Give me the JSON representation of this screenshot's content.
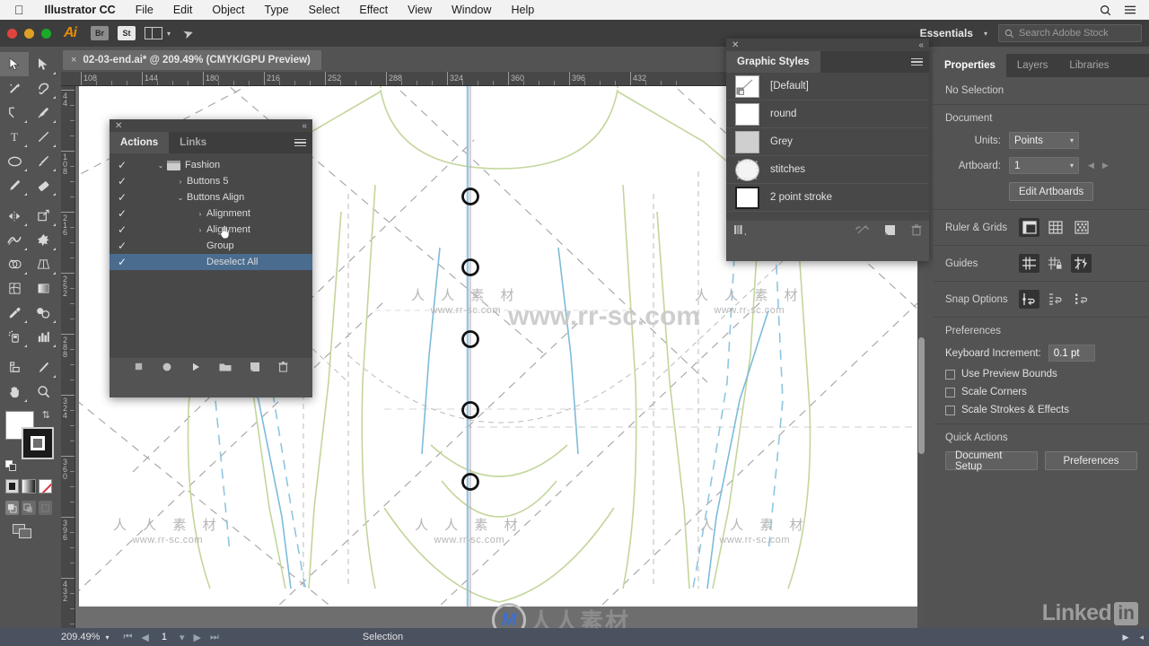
{
  "os_menu": {
    "apple": "apple-logo",
    "app_name": "Illustrator CC",
    "items": [
      "File",
      "Edit",
      "Object",
      "Type",
      "Select",
      "Effect",
      "View",
      "Window",
      "Help"
    ],
    "right_icons": [
      "search-icon",
      "control-center-icon"
    ]
  },
  "appbar": {
    "logo": "Ai",
    "bridge_label": "Br",
    "stock_label": "St",
    "arrange_label": "arrange-documents",
    "rocket_label": "rocket-icon",
    "workspace": "Essentials",
    "search_placeholder": "Search Adobe Stock"
  },
  "document": {
    "tab_title": "02-03-end.ai* @ 209.49% (CMYK/GPU Preview)",
    "close_glyph": "×"
  },
  "rulers": {
    "horizontal_ticks": [
      "108",
      "144",
      "180",
      "216",
      "252",
      "288",
      "324",
      "360",
      "396",
      "432"
    ],
    "vertical_ticks": [
      "44",
      "108",
      "216",
      "252",
      "288",
      "324",
      "360",
      "396",
      "432"
    ]
  },
  "tools": {
    "items": [
      "selection-tool",
      "direct-selection-tool",
      "magic-wand-tool",
      "lasso-tool",
      "pen-tool",
      "curvature-tool",
      "type-tool",
      "line-segment-tool",
      "ellipse-tool",
      "paintbrush-tool",
      "pencil-tool",
      "eraser-tool",
      "rotate-tool",
      "scale-tool",
      "width-tool",
      "free-transform-tool",
      "shape-builder-tool",
      "perspective-grid-tool",
      "mesh-tool",
      "gradient-tool",
      "eyedropper-tool",
      "blend-tool",
      "symbol-sprayer-tool",
      "column-graph-tool",
      "artboard-tool",
      "slice-tool",
      "hand-tool",
      "zoom-tool"
    ],
    "selected": "selection-tool",
    "fill_color": "#ffffff",
    "stroke_color": "#1a1a1a",
    "color_modes": [
      "color-mode",
      "gradient-mode",
      "none-mode"
    ],
    "draw_modes": [
      "draw-normal",
      "draw-behind",
      "draw-inside"
    ],
    "screen_mode": "change-screen-mode"
  },
  "actions_panel": {
    "tabs": [
      {
        "label": "Actions",
        "active": true
      },
      {
        "label": "Links",
        "active": false
      }
    ],
    "rows": [
      {
        "check": "✓",
        "indent": 0,
        "arrow": "⌄",
        "folder": true,
        "label": "Fashion",
        "selected": false
      },
      {
        "check": "✓",
        "indent": 1,
        "arrow": "›",
        "folder": false,
        "label": "Buttons 5",
        "selected": false
      },
      {
        "check": "✓",
        "indent": 1,
        "arrow": "⌄",
        "folder": false,
        "label": "Buttons Align",
        "selected": false
      },
      {
        "check": "✓",
        "indent": 2,
        "arrow": "›",
        "folder": false,
        "label": "Alignment",
        "selected": false
      },
      {
        "check": "✓",
        "indent": 2,
        "arrow": "›",
        "folder": false,
        "label": "Alignment",
        "selected": false
      },
      {
        "check": "✓",
        "indent": 2,
        "arrow": "",
        "folder": false,
        "label": "Group",
        "selected": false
      },
      {
        "check": "✓",
        "indent": 2,
        "arrow": "",
        "folder": false,
        "label": "Deselect All",
        "selected": true
      }
    ],
    "footer_buttons": [
      "stop-button",
      "record-button",
      "play-button",
      "new-set-button",
      "new-action-button",
      "delete-button"
    ]
  },
  "graphic_styles_panel": {
    "title": "Graphic Styles",
    "items": [
      {
        "label": "[Default]",
        "thumb": "default"
      },
      {
        "label": "round",
        "thumb": "plain"
      },
      {
        "label": "Grey",
        "thumb": "grey"
      },
      {
        "label": "stitches",
        "thumb": "dot"
      },
      {
        "label": "2 point stroke",
        "thumb": "dark"
      }
    ],
    "footer_buttons": [
      "styles-libraries-button",
      "break-link-button",
      "new-style-button",
      "delete-style-button"
    ]
  },
  "properties_panel": {
    "tabs": [
      {
        "label": "Properties",
        "active": true
      },
      {
        "label": "Layers",
        "active": false
      },
      {
        "label": "Libraries",
        "active": false
      }
    ],
    "selection_status": "No Selection",
    "document": {
      "heading": "Document",
      "units_label": "Units:",
      "units_value": "Points",
      "artboard_label": "Artboard:",
      "artboard_value": "1",
      "edit_artboards_button": "Edit Artboards"
    },
    "ruler_grids": {
      "label": "Ruler & Grids",
      "buttons": [
        "show-rulers-icon",
        "show-grid-icon",
        "show-transparency-grid-icon"
      ],
      "active_index": 0
    },
    "guides": {
      "label": "Guides",
      "buttons": [
        "show-guides-icon",
        "lock-guides-icon",
        "smart-guides-icon"
      ],
      "active_index": 0
    },
    "snap_options": {
      "label": "Snap Options",
      "buttons": [
        "snap-to-point-icon",
        "snap-to-grid-icon",
        "snap-to-pixel-icon"
      ],
      "active_index": 0
    },
    "preferences": {
      "heading": "Preferences",
      "keyboard_increment_label": "Keyboard Increment:",
      "keyboard_increment_value": "0.1 pt",
      "checkboxes": [
        {
          "label": "Use Preview Bounds",
          "checked": false
        },
        {
          "label": "Scale Corners",
          "checked": false
        },
        {
          "label": "Scale Strokes & Effects",
          "checked": false
        }
      ]
    },
    "quick_actions": {
      "heading": "Quick Actions",
      "buttons": [
        "Document Setup",
        "Preferences"
      ]
    }
  },
  "statusbar": {
    "zoom": "209.49%",
    "artboard_number": "1",
    "tool_status": "Selection"
  },
  "watermarks": {
    "cn_text": "人 人 素 材",
    "url_text": "www.rr-sc.com",
    "big_url": "www.rr-sc.com",
    "logo_cn": "人人素材",
    "linkedin_text": "Linked",
    "linkedin_badge": "in"
  },
  "colors": {
    "chrome": "#535353",
    "panel_dark": "#3d3d3d",
    "list_bg": "#484848",
    "selection_blue": "#4a6c8f",
    "statusbar": "#4a5260",
    "artwork_green": "#b9cf8a",
    "artwork_blue": "#93c9e0",
    "guide_grey": "#9a9a9a"
  }
}
